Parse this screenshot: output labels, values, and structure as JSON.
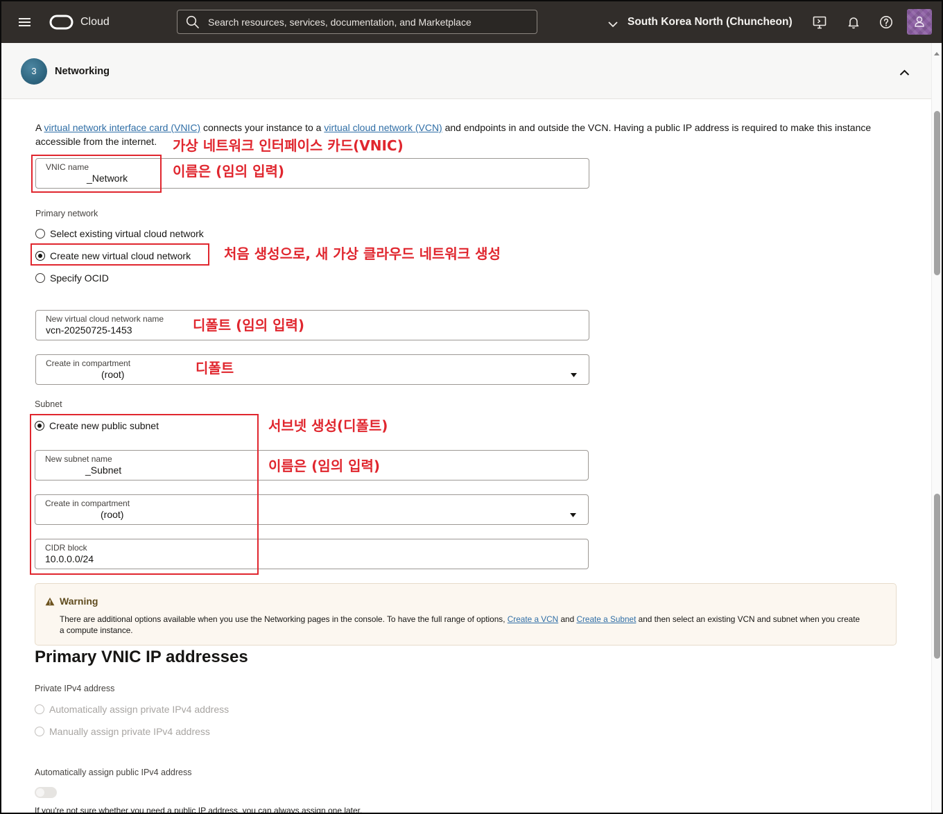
{
  "colors": {
    "nav_bg": "#312d2a",
    "annotation_red": "#e0262e",
    "link": "#2f6ea6",
    "step_badge": "#2f6680",
    "warning_bg": "#fcf7f0"
  },
  "nav": {
    "menu_icon": "hamburger-menu-icon",
    "logo_icon": "oracle-logo-icon",
    "brand": "Cloud",
    "search_icon": "search-icon",
    "search_placeholder": "Search resources, services, documentation, and Marketplace",
    "region_icon": "chevron-down-icon",
    "region": "South Korea North (Chuncheon)",
    "action_icons": [
      "cloud-shell-icon",
      "bell-icon",
      "help-icon"
    ],
    "avatar_icon": "user-avatar-icon"
  },
  "section": {
    "step": "3",
    "title": "Networking",
    "collapse_icon": "chevron-up-icon"
  },
  "intro": {
    "lead": "A",
    "vnic_link": "virtual network interface card (VNIC)",
    "mid": "connects your instance to a",
    "vcn_link": "virtual cloud network (VCN)",
    "tail": "and endpoints in and outside the VCN. Having a public IP address is required to make this instance",
    "tail_line2": "accessible from the internet."
  },
  "annotations": {
    "vnic": "가상 네트워크 인터페이스 카드(VNIC)",
    "vnic_name": "이름은 (임의 입력)",
    "create_vcn": "처음 생성으로, 새 가상 클라우드 네트워크 생성",
    "vcn_name": "디폴트 (임의 입력)",
    "compartment": "디폴트",
    "subnet": "서브넷 생성(디폴트)",
    "subnet_name": "이름은 (임의 입력)"
  },
  "vnic": {
    "label": "VNIC name",
    "value": "_Network"
  },
  "primary_network": {
    "label": "Primary network",
    "options": [
      {
        "label": "Select existing virtual cloud network",
        "selected": false
      },
      {
        "label": "Create new virtual cloud network",
        "selected": true
      },
      {
        "label": "Specify OCID",
        "selected": false
      }
    ],
    "vcn_name": {
      "label": "New virtual cloud network name",
      "value": "vcn-20250725-1453"
    },
    "compartment": {
      "label": "Create in compartment",
      "value": "(root)"
    }
  },
  "subnet": {
    "label": "Subnet",
    "option": {
      "label": "Create new public subnet",
      "selected": true
    },
    "name": {
      "label": "New subnet name",
      "value": "_Subnet"
    },
    "compartment": {
      "label": "Create in compartment",
      "value": "(root)"
    },
    "cidr": {
      "label": "CIDR block",
      "value": "10.0.0.0/24"
    }
  },
  "warning": {
    "icon": "warning-icon",
    "title": "Warning",
    "text_1": "There are additional options available when you use the Networking pages in the console. To have the full range of options,",
    "link_vcn": "Create a VCN",
    "text_2": "and",
    "link_subnet": "Create a Subnet",
    "text_3": "and then select an existing VCN and subnet when you create",
    "text_4": "a compute instance."
  },
  "ip_addresses": {
    "heading": "Primary VNIC IP addresses",
    "private_label": "Private IPv4 address",
    "private_options": [
      {
        "label": "Automatically assign private IPv4 address",
        "selected": false,
        "disabled": true
      },
      {
        "label": "Manually assign private IPv4 address",
        "selected": false,
        "disabled": true
      }
    ],
    "public_label": "Automatically assign public IPv4 address",
    "public_enabled": false,
    "public_hint": "If you're not sure whether you need a public IP address, you can always assign one later."
  }
}
